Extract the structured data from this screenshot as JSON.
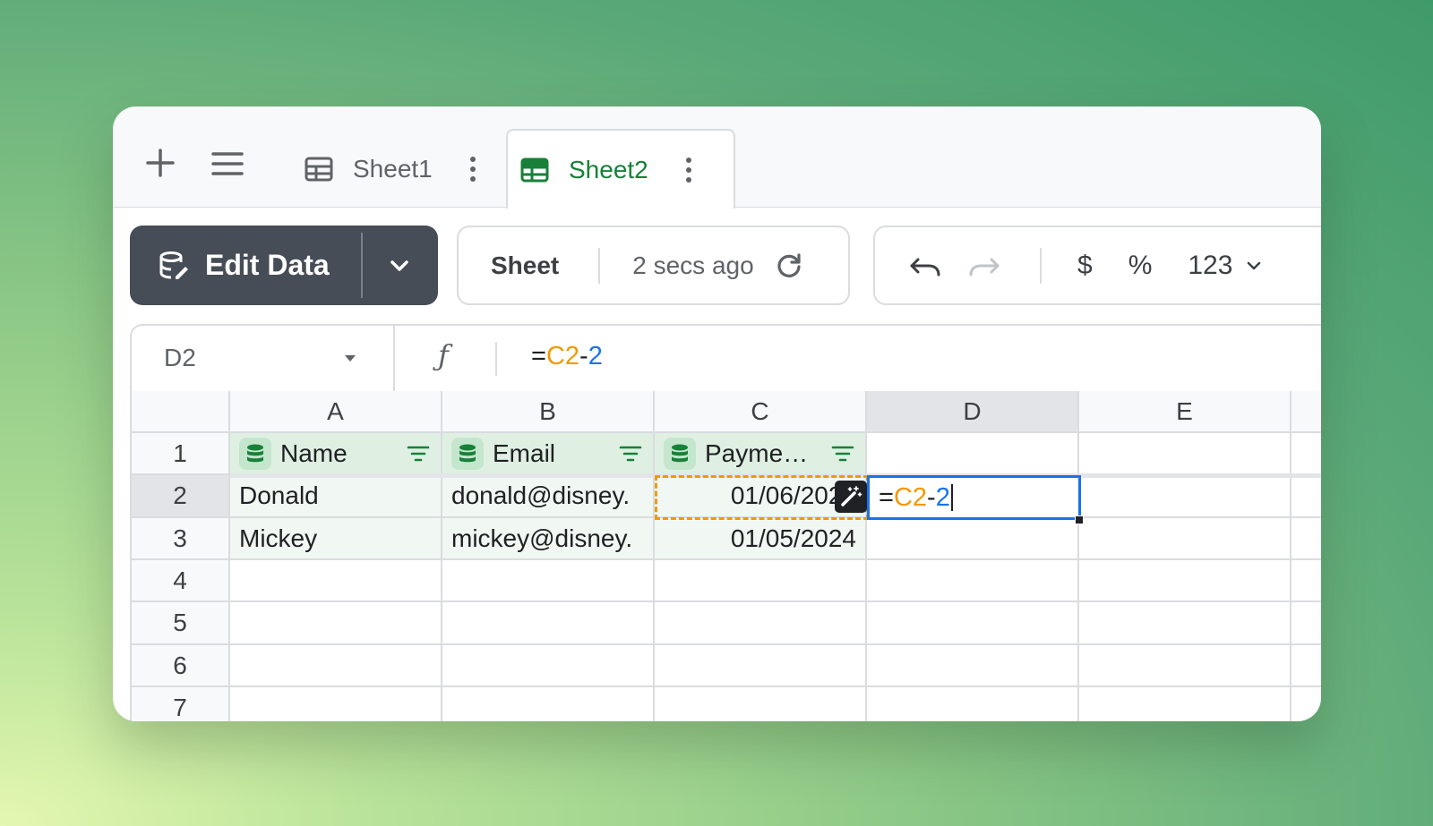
{
  "tabs": {
    "add_icon": "plus-icon",
    "menu_icon": "hamburger-icon",
    "items": [
      {
        "label": "Sheet1",
        "active": false
      },
      {
        "label": "Sheet2",
        "active": true
      }
    ]
  },
  "toolbar": {
    "edit_data_label": "Edit Data",
    "sheet_label": "Sheet",
    "saved_status": "2 secs ago",
    "currency_label": "$",
    "percent_label": "%",
    "number_format_label": "123"
  },
  "formula_bar": {
    "cell_ref": "D2",
    "fx": "ƒ",
    "formula_parts": [
      "=",
      "C2",
      "-",
      "2"
    ]
  },
  "grid": {
    "columns": [
      "A",
      "B",
      "C",
      "D",
      "E"
    ],
    "rows": [
      "1",
      "2",
      "3",
      "4",
      "5",
      "6",
      "7"
    ],
    "headers": [
      "Name",
      "Email",
      "Payme…"
    ],
    "data": [
      [
        "Donald",
        "donald@disney.",
        "01/06/2024"
      ],
      [
        "Mickey",
        "mickey@disney.",
        "01/05/2024"
      ]
    ],
    "editing_cell": {
      "ref": "D2",
      "parts": [
        "=",
        "C2",
        "-",
        "2"
      ]
    }
  },
  "colors": {
    "accent_green": "#188038",
    "accent_orange": "#f29900",
    "accent_blue": "#1a73e8",
    "edit_button_bg": "#474d57"
  }
}
